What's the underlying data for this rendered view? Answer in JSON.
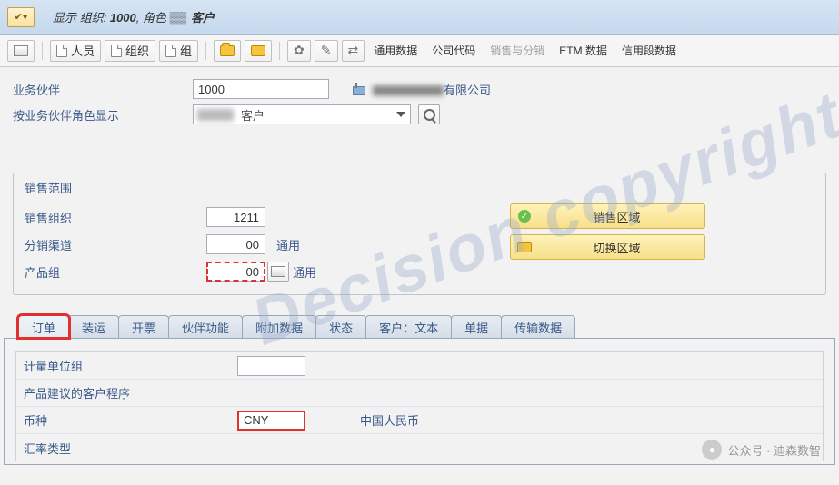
{
  "titlebar": {
    "prefix": "显示 组织: ",
    "org": "1000",
    "suffix": ", 角色 ",
    "role": "客户"
  },
  "toolbar": {
    "person": "人员",
    "org": "组织",
    "group": "组",
    "general": "通用数据",
    "company": "公司代码",
    "sales": "销售与分销",
    "etm": "ETM 数据",
    "credit": "信用段数据"
  },
  "header": {
    "partner_lbl": "业务伙伴",
    "partner_val": "1000",
    "partner_name": "有限公司",
    "role_lbl": "按业务伙伴角色显示",
    "role_val": "客户"
  },
  "sales_area": {
    "title": "销售范围",
    "org_lbl": "销售组织",
    "org_val": "1211",
    "channel_lbl": "分销渠道",
    "channel_val": "00",
    "channel_txt": "通用",
    "division_lbl": "产品组",
    "division_val": "00",
    "division_txt": "通用",
    "btn_area": "销售区域",
    "btn_switch": "切换区域"
  },
  "tabs": [
    "订单",
    "装运",
    "开票",
    "伙伴功能",
    "附加数据",
    "状态",
    "客户：文本",
    "单据",
    "传输数据"
  ],
  "order": {
    "uom_lbl": "计量单位组",
    "uom_val": "",
    "prop_lbl": "产品建议的客户程序",
    "curr_lbl": "币种",
    "curr_val": "CNY",
    "curr_txt": "中国人民币",
    "rate_lbl": "汇率类型"
  },
  "watermark": "Decision copyright",
  "wechat": "公众号 · 迪森数智"
}
